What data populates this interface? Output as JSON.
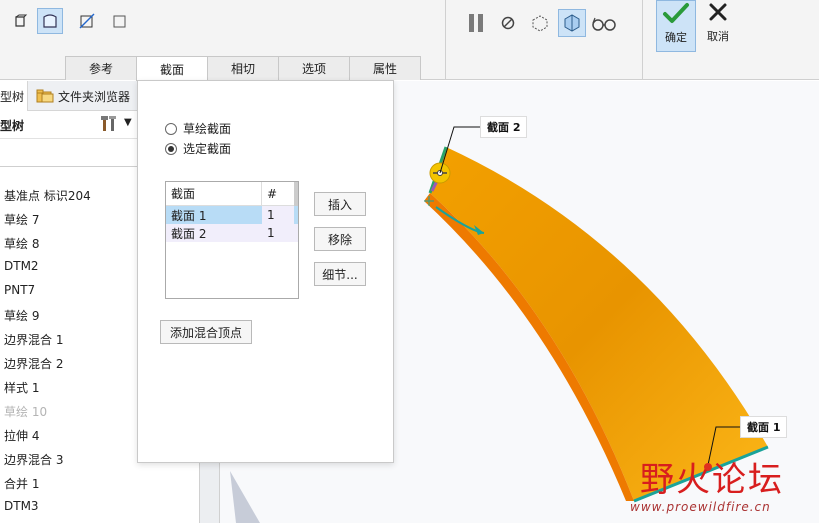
{
  "ribbon": {
    "tabs": [
      "参考",
      "截面",
      "相切",
      "选项",
      "属性"
    ],
    "active_tab": "截面",
    "ok_label": "确定",
    "cancel_label": "取消"
  },
  "model_tree": {
    "tab_left": "型树",
    "tab_right": "文件夹浏览器",
    "header": "型树",
    "items": [
      {
        "label": "基准点 标识204",
        "dim": false
      },
      {
        "label": "草绘 7",
        "dim": false
      },
      {
        "label": "草绘 8",
        "dim": false
      },
      {
        "label": "DTM2",
        "dim": false
      },
      {
        "label": "PNT7",
        "dim": false
      },
      {
        "label": "草绘 9",
        "dim": false
      },
      {
        "label": "边界混合 1",
        "dim": false
      },
      {
        "label": "边界混合 2",
        "dim": false
      },
      {
        "label": "样式 1",
        "dim": false
      },
      {
        "label": "草绘 10",
        "dim": true
      },
      {
        "label": "拉伸 4",
        "dim": false
      },
      {
        "label": "边界混合 3",
        "dim": false
      },
      {
        "label": "合并 1",
        "dim": false
      },
      {
        "label": "DTM3",
        "dim": false
      }
    ]
  },
  "sections_panel": {
    "radio_sketched": "草绘截面",
    "radio_selected": "选定截面",
    "table_header_section": "截面",
    "table_header_num": "#",
    "rows": [
      {
        "section": "截面 1",
        "num": "1"
      },
      {
        "section": "截面 2",
        "num": "1"
      }
    ],
    "insert_label": "插入",
    "remove_label": "移除",
    "details_label": "细节...",
    "add_vertex_label": "添加混合顶点"
  },
  "callouts": {
    "section2": "截面 2",
    "section1": "截面 1"
  },
  "watermark": {
    "cn": "野火论坛",
    "en": "www.proewildfire.cn"
  },
  "colors": {
    "surface": "#f6a500",
    "edge_teal": "#1aa39a",
    "accent_blue": "#cde3f7"
  }
}
